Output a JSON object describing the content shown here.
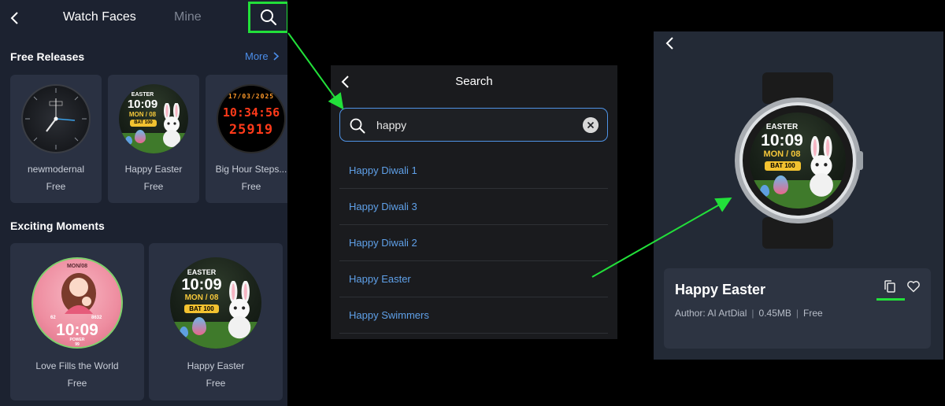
{
  "panel1": {
    "tabs": [
      {
        "label": "Watch Faces"
      },
      {
        "label": "Mine"
      }
    ],
    "free_releases": {
      "title": "Free Releases",
      "more": "More",
      "items": [
        {
          "name": "newmodernal",
          "price": "Free"
        },
        {
          "name": "Happy Easter",
          "price": "Free"
        },
        {
          "name": "Big Hour Steps...",
          "price": "Free"
        }
      ]
    },
    "exciting_moments": {
      "title": "Exciting Moments",
      "items": [
        {
          "name": "Love Fills the World",
          "price": "Free"
        },
        {
          "name": "Happy Easter",
          "price": "Free"
        }
      ]
    },
    "dials": {
      "easter": {
        "top": "EASTER",
        "time": "10:09",
        "date": "MON / 08",
        "bat": "BAT 100"
      },
      "digital": {
        "date": "17/03/2025",
        "row1": "10:34:56",
        "row2": "25919"
      },
      "love": {
        "top": "MON/08",
        "left": "62",
        "right": "8632",
        "time": "10:09",
        "bottom_label": "POWER",
        "bottom_value": "99"
      }
    }
  },
  "panel2": {
    "title": "Search",
    "search": {
      "value": "happy",
      "placeholder": ""
    },
    "results": [
      {
        "label": "Happy Diwali 1"
      },
      {
        "label": "Happy Diwali 3"
      },
      {
        "label": "Happy Diwali 2"
      },
      {
        "label": "Happy Easter"
      },
      {
        "label": "Happy Swimmers"
      }
    ]
  },
  "panel3": {
    "title": "Happy Easter",
    "author": "Author: AI ArtDial",
    "size": "0.45MB",
    "price": "Free",
    "dial": {
      "top": "EASTER",
      "time": "10:09",
      "date": "MON / 08",
      "bat": "BAT 100"
    }
  },
  "colors": {
    "highlight": "#22e03a",
    "link": "#4b8de8",
    "result_link": "#5fa0e8",
    "panel_bg": "#1c2230",
    "card_bg": "#2a3142"
  },
  "icons": [
    "back-chevron-icon",
    "search-icon",
    "chevron-right-icon",
    "clear-icon",
    "copy-icon",
    "heart-icon"
  ]
}
